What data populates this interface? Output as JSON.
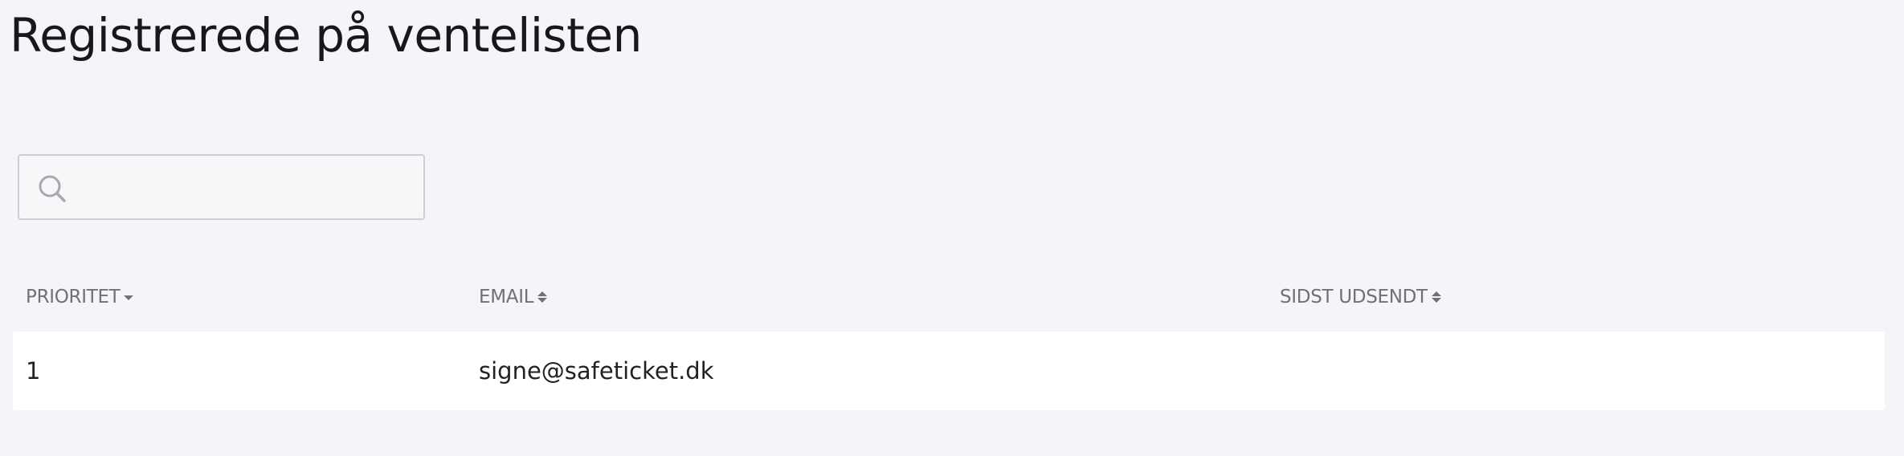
{
  "page": {
    "title": "Registrerede på ventelisten"
  },
  "search": {
    "value": "",
    "placeholder": "",
    "icon": "search-icon"
  },
  "table": {
    "columns": [
      {
        "key": "priority",
        "label": "PRIORITET",
        "sort": "desc",
        "sort_icon": "caret-down-icon"
      },
      {
        "key": "email",
        "label": "EMAIL",
        "sort": "none",
        "sort_icon": "sort-icon"
      },
      {
        "key": "last_sent",
        "label": "SIDST UDSENDT",
        "sort": "none",
        "sort_icon": "sort-icon"
      }
    ],
    "rows": [
      {
        "priority": "1",
        "email": "signe@safeticket.dk",
        "last_sent": ""
      }
    ]
  },
  "colors": {
    "background": "#f5f4f8",
    "row_background": "#ffffff",
    "header_text": "#707075",
    "body_text": "#222226",
    "input_border": "#cfced3"
  }
}
